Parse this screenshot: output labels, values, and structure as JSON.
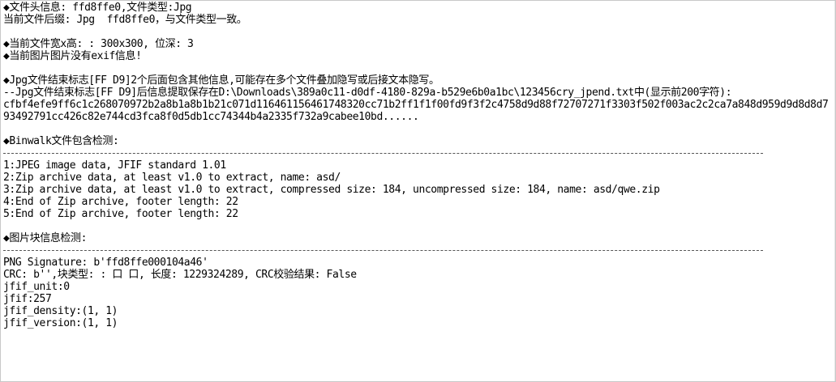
{
  "header": {
    "line1": "◆文件头信息: ffd8ffe0,文件类型:Jpg",
    "line2": "当前文件后缀: Jpg  ffd8ffe0，与文件类型一致。"
  },
  "dimensions": {
    "line1": "◆当前文件宽x高: : 300x300, 位深: 3",
    "line2": "◆当前图片图片没有exif信息!"
  },
  "jpg_end": {
    "line1": "◆Jpg文件结束标志[FF D9]2个后面包含其他信息,可能存在多个文件叠加隐写或后接文本隐写。",
    "line2": "--Jpg文件结束标志[FF D9]后信息提取保存在D:\\Downloads\\389a0c11-d0df-4180-829a-b529e6b0a1bc\\123456cry_jpend.txt中(显示前200字符):",
    "hex": "cfbf4efe9ff6c1c268070972b2a8b1a8b1b21c071d116461156461748320cc71b2ff1f1f00fd9f3f2c4758d9d88f72707271f3303f502f003ac2c2ca7a848d959d9d8d8d793492791cc426c82e744cd3fca8f0d5db1cc74344b4a2335f732a9cabee10bd......"
  },
  "binwalk": {
    "title": "◆Binwalk文件包含检测:",
    "results": [
      "1:JPEG image data, JFIF standard 1.01",
      "2:Zip archive data, at least v1.0 to extract, name: asd/",
      "3:Zip archive data, at least v1.0 to extract, compressed size: 184, uncompressed size: 184, name: asd/qwe.zip",
      "4:End of Zip archive, footer length: 22",
      "5:End of Zip archive, footer length: 22"
    ]
  },
  "chunks": {
    "title": "◆图片块信息检测:",
    "lines": [
      "PNG Signature: b'ffd8ffe000104a46'",
      "CRC: b'',块类型: : 口 口, 长度: 1229324289, CRC校验结果: False",
      "jfif_unit:0",
      "jfif:257",
      "jfif_density:(1, 1)",
      "jfif_version:(1, 1)"
    ]
  }
}
